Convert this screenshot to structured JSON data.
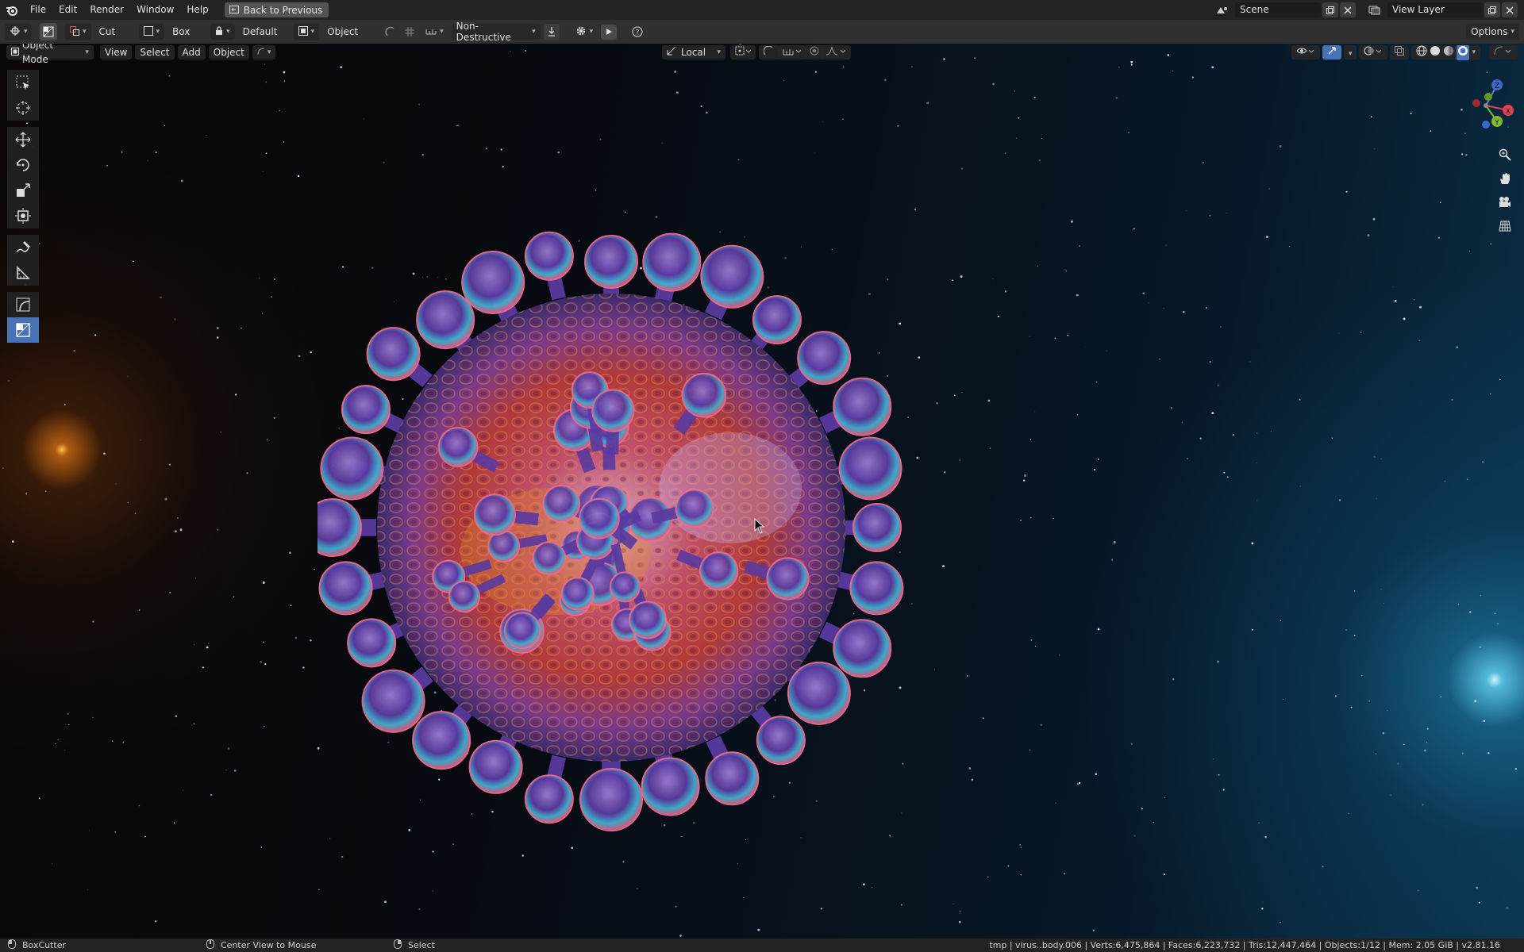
{
  "menubar": {
    "items": [
      "File",
      "Edit",
      "Render",
      "Window",
      "Help"
    ],
    "back_label": "Back to Previous",
    "scene": "Scene",
    "view_layer": "View Layer"
  },
  "toolbar": {
    "cut": "Cut",
    "box": "Box",
    "default": "Default",
    "object": "Object",
    "mode": "Non-Destructive",
    "options": "Options"
  },
  "viewport_header": {
    "mode": "Object Mode",
    "view": "View",
    "select": "Select",
    "add": "Add",
    "object": "Object",
    "orientation": "Local"
  },
  "gizmo": {
    "z": "Z",
    "y": "Y",
    "x": "X"
  },
  "statusbar": {
    "left_action": "BoxCutter",
    "middle_action": "Center View to Mouse",
    "right_action": "Select",
    "stats": "tmp | virus..body.006 | Verts:6,475,864 | Faces:6,223,732 | Tris:12,447,464 | Objects:1/12 | Mem: 2.05 GiB | v2.81.16"
  },
  "colors": {
    "accent": "#4772b3",
    "menubar_bg": "#232323",
    "toolbar_bg": "#303030"
  }
}
